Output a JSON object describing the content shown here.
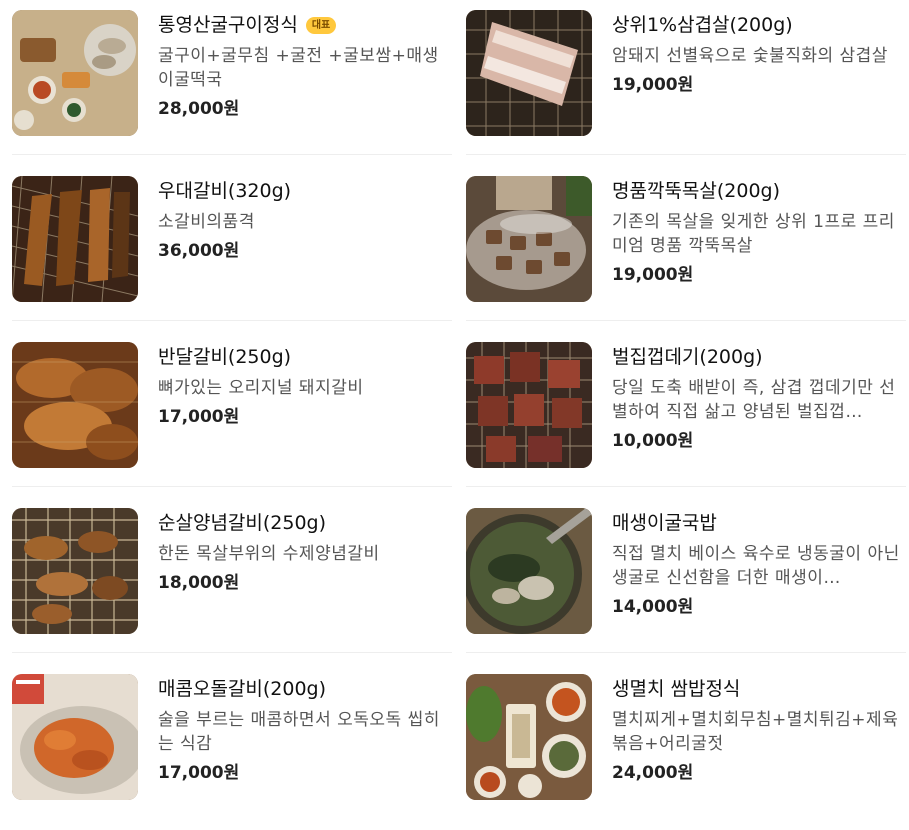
{
  "menu": {
    "left": [
      {
        "name": "통영산굴구이정식",
        "badge": "대표",
        "desc": "굴구이+굴무침 +굴전 +굴보쌈+매생이굴떡국",
        "price": "28,000원"
      },
      {
        "name": "우대갈비(320g)",
        "desc": "소갈비의품격",
        "price": "36,000원"
      },
      {
        "name": "반달갈비(250g)",
        "desc": "뼈가있는 오리지널 돼지갈비",
        "price": "17,000원"
      },
      {
        "name": "순살양념갈비(250g)",
        "desc": "한돈 목살부위의 수제양념갈비",
        "price": "18,000원"
      },
      {
        "name": "매콤오돌갈비(200g)",
        "desc": "술을 부르는 매콤하면서 오독오독 씹히는 식감",
        "price": "17,000원"
      }
    ],
    "right": [
      {
        "name": "상위1%삼겹살(200g)",
        "desc": "암돼지 선별육으로 숯불직화의 삼겹살",
        "price": "19,000원"
      },
      {
        "name": "명품깍뚝목살(200g)",
        "desc": "기존의 목살을 잊게한 상위 1프로 프리미엄 명품 깍뚝목살",
        "price": "19,000원"
      },
      {
        "name": "벌집껍데기(200g)",
        "desc": "당일 도축 배받이 즉, 삼겹 껍데기만 선별하여 직접 삶고 양념된 벌집껍…",
        "price": "10,000원"
      },
      {
        "name": "매생이굴국밥",
        "desc": "직접 멸치 베이스 육수로 냉동굴이 아닌 생굴로 신선함을 더한 매생이…",
        "price": "14,000원"
      },
      {
        "name": "생멸치 쌈밥정식",
        "desc": "멸치찌게+멸치회무침+멸치튀김+제육볶음+어리굴젓",
        "price": "24,000원"
      }
    ]
  },
  "thumb_colors": [
    "#b79a76",
    "#6b3f22",
    "#9b5a2a",
    "#a2682f",
    "#c8743a",
    "#8c6c62",
    "#6a5a4a",
    "#8d3b2a",
    "#5e6a45",
    "#7f5a3c"
  ]
}
